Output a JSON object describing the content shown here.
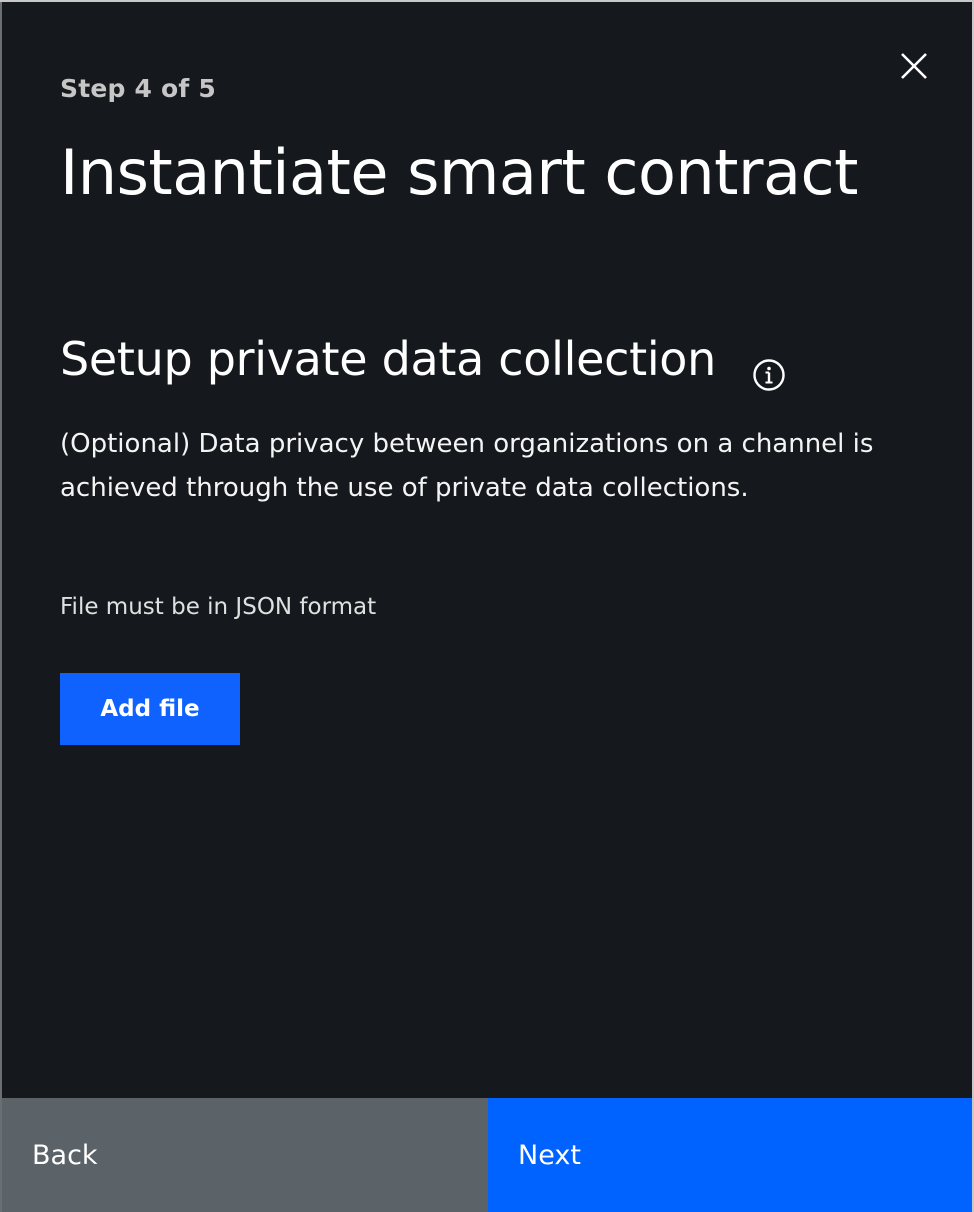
{
  "modal": {
    "step": "Step 4 of 5",
    "title": "Instantiate smart contract",
    "close_icon": "close-icon",
    "section": {
      "title": "Setup private data collection",
      "info_icon": "information-icon",
      "description": "(Optional) Data privacy between organizations on a channel is achieved through the use of private data collections.",
      "hint": "File must be in JSON format",
      "add_file_label": "Add file"
    },
    "footer": {
      "back_label": "Back",
      "next_label": "Next"
    }
  },
  "colors": {
    "background": "#15191d",
    "primary": "#0f62fe",
    "secondary": "#5b6268"
  }
}
